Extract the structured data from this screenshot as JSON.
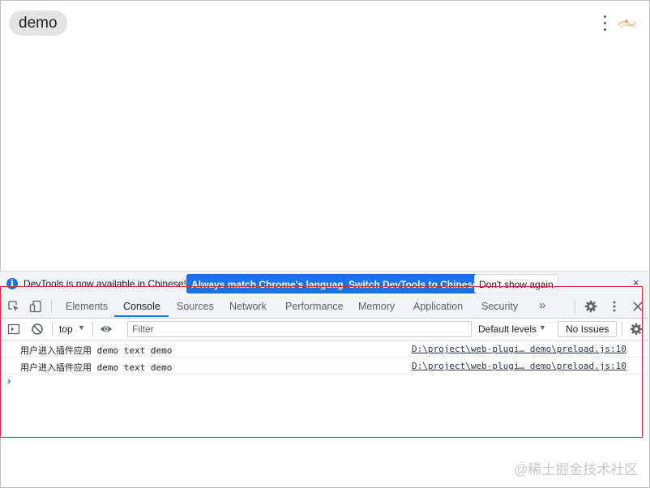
{
  "plugin_bar": {
    "tag": "demo"
  },
  "banner": {
    "message": "DevTools is now available in Chinese!",
    "match_language": "Always match Chrome's language",
    "switch_language": "Switch DevTools to Chinese",
    "dismiss": "Don't show again",
    "close": "×"
  },
  "tabs": [
    {
      "label": "Elements"
    },
    {
      "label": "Console",
      "active": true
    },
    {
      "label": "Sources"
    },
    {
      "label": "Network"
    },
    {
      "label": "Performance"
    },
    {
      "label": "Memory"
    },
    {
      "label": "Application"
    },
    {
      "label": "Security"
    }
  ],
  "tabs_overflow": "»",
  "console_toolbar": {
    "context": "top",
    "filter_placeholder": "Filter",
    "levels": "Default levels",
    "issues": "No Issues"
  },
  "messages": [
    {
      "text": "用户进入插件应用 demo text demo",
      "source": "D:\\project\\web-plugi… demo\\preload.js:10"
    },
    {
      "text": "用户进入插件应用 demo text demo",
      "source": "D:\\project\\web-plugi… demo\\preload.js:10"
    }
  ],
  "prompt": "›",
  "watermark": "@稀土掘金技术社区",
  "colors": {
    "accent": "#1a73e8",
    "annotation": "#d7263d"
  }
}
